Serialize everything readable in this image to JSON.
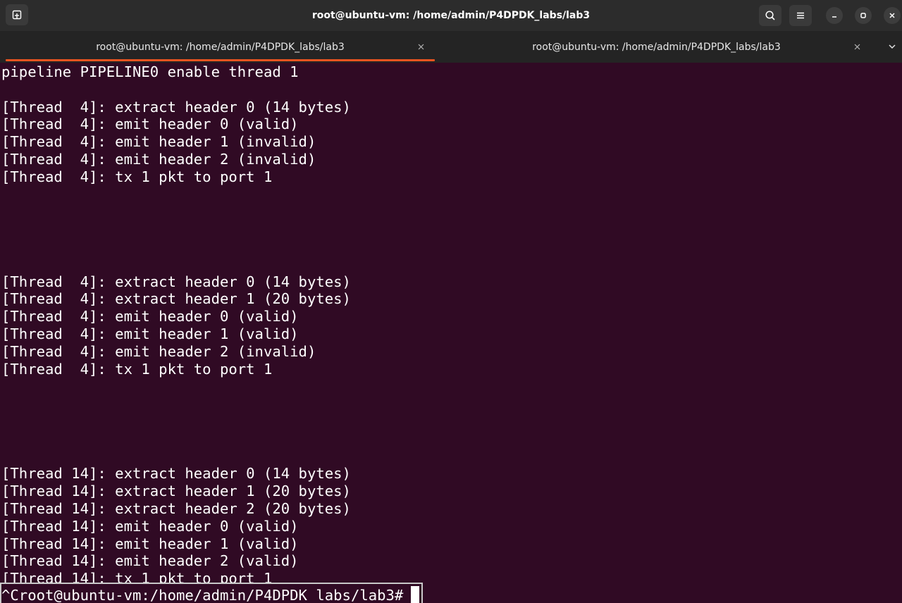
{
  "window": {
    "title": "root@ubuntu-vm: /home/admin/P4DPDK_labs/lab3"
  },
  "headerbar": {
    "left_icon": "new-tab-icon",
    "search_icon": "search-icon",
    "menu_icon": "hamburger-menu-icon",
    "minimize_icon": "minimize-icon",
    "maximize_icon": "maximize-icon",
    "close_icon": "close-icon"
  },
  "tabs": [
    {
      "label": "root@ubuntu-vm: /home/admin/P4DPDK_labs/lab3",
      "active": true
    },
    {
      "label": "root@ubuntu-vm: /home/admin/P4DPDK_labs/lab3",
      "active": false
    }
  ],
  "terminal": {
    "lines": [
      "pipeline PIPELINE0 enable thread 1",
      "",
      "[Thread  4]: extract header 0 (14 bytes)",
      "[Thread  4]: emit header 0 (valid)",
      "[Thread  4]: emit header 1 (invalid)",
      "[Thread  4]: emit header 2 (invalid)",
      "[Thread  4]: tx 1 pkt to port 1",
      "",
      "",
      "",
      "",
      "",
      "[Thread  4]: extract header 0 (14 bytes)",
      "[Thread  4]: extract header 1 (20 bytes)",
      "[Thread  4]: emit header 0 (valid)",
      "[Thread  4]: emit header 1 (valid)",
      "[Thread  4]: emit header 2 (invalid)",
      "[Thread  4]: tx 1 pkt to port 1",
      "",
      "",
      "",
      "",
      "",
      "[Thread 14]: extract header 0 (14 bytes)",
      "[Thread 14]: extract header 1 (20 bytes)",
      "[Thread 14]: extract header 2 (20 bytes)",
      "[Thread 14]: emit header 0 (valid)",
      "[Thread 14]: emit header 1 (valid)",
      "[Thread 14]: emit header 2 (valid)",
      "[Thread 14]: tx 1 pkt to port 1"
    ],
    "prompt": "^Croot@ubuntu-vm:/home/admin/P4DPDK_labs/lab3# "
  },
  "colors": {
    "terminal_bg": "#300a24",
    "accent": "#e95420",
    "headerbar_bg": "#2c2c2c",
    "tabbar_bg": "#242424"
  }
}
